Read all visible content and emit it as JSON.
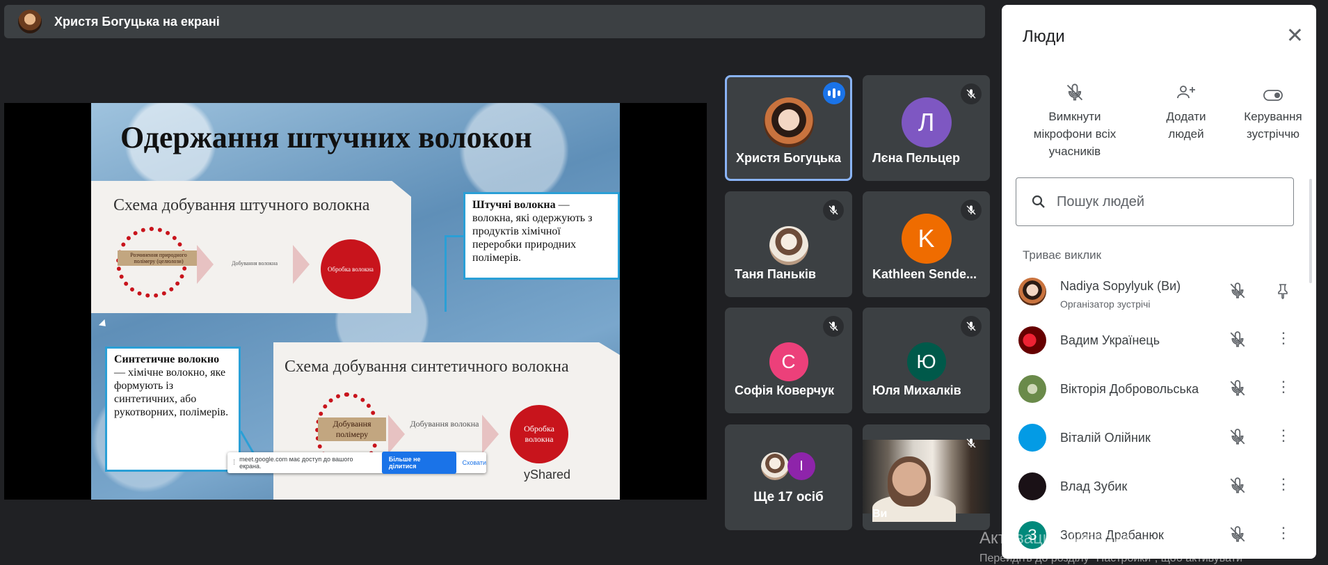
{
  "topbar": {
    "title": "Христя Богуцька на екрані"
  },
  "slide": {
    "title": "Одержання штучних волокон",
    "card1": {
      "title": "Схема добування штучного волокна",
      "step1": "Розчинення природного полімеру (целюлози)",
      "step2": "Добування волокна",
      "step3": "Обробка волокна"
    },
    "card2": {
      "title": "Схема добування синтетичного волокна",
      "step1": "Добування полімеру",
      "step2": "Добування волокна",
      "step3": "Обробка волокна",
      "watermark": "yShared"
    },
    "note1": {
      "term": "Штучні волокна",
      "text": " — волокна, які одержують з продуктів хімічної переробки природних полімерів."
    },
    "note2": {
      "term": "Синтетичне волокно",
      "text": " — хімічне волокно, яке формують із синтетичних, або рукотворних, полімерів."
    }
  },
  "sharebar": {
    "message": "meet.google.com має доступ до вашого екрана.",
    "stop_label": "Більше не ділитися",
    "hide_label": "Сховати"
  },
  "tiles": [
    {
      "name": "Христя Богуцька"
    },
    {
      "name": "Лєна Пельцер",
      "initial": "Л",
      "color": "#7e57c2"
    },
    {
      "name": "Таня Паньків"
    },
    {
      "name": "Kathleen Sende...",
      "initial": "K",
      "color": "#ef6c00"
    },
    {
      "name": "Софія Коверчук",
      "initial": "С",
      "color": "#ec407a"
    },
    {
      "name": "Юля Михалків",
      "initial": "Ю",
      "color": "#00594a"
    },
    {
      "name": "Ще 17 осіб",
      "initial": "I",
      "color": "#8e24aa"
    },
    {
      "name": "Ви"
    }
  ],
  "panel": {
    "title": "Люди",
    "actions": {
      "mute_all": "Вимкнути мікрофони всіх учасників",
      "add_people": "Додати людей",
      "host_controls": "Керування зустріччю"
    },
    "search_placeholder": "Пошук людей",
    "section": "Триває виклик",
    "people": [
      {
        "name": "Nadiya Sopylyuk (Ви)",
        "subtitle": "Організатор зустрічі"
      },
      {
        "name": "Вадим Українець"
      },
      {
        "name": "Вікторія Добровольська"
      },
      {
        "name": "Віталій Олійник",
        "color": "#039be5"
      },
      {
        "name": "Влад Зубик",
        "color": "#1a1116"
      },
      {
        "name": "Зоряна Драбанюк",
        "initial": "З",
        "color": "#00897b"
      }
    ]
  },
  "watermark": {
    "line1": "Активация Windows",
    "line2": "Перейдіть до розділу \"Настройки\", щоб активувати"
  }
}
